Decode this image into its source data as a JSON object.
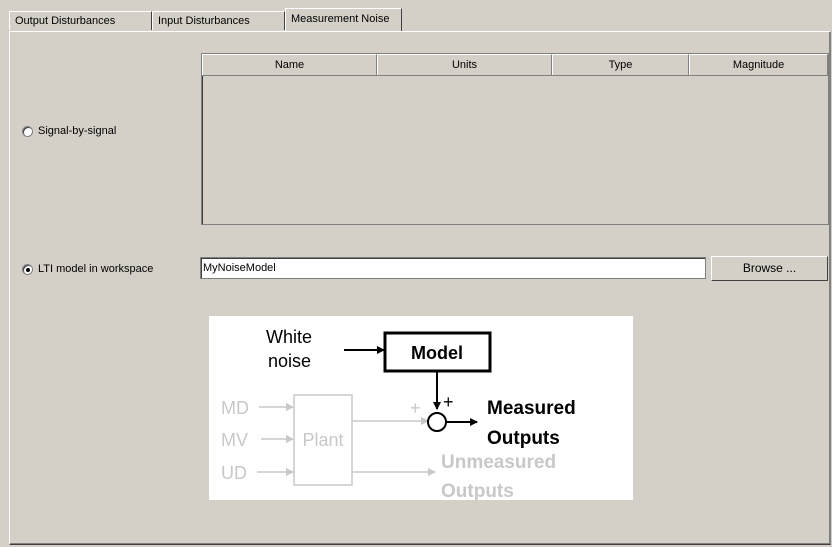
{
  "tabs": [
    {
      "label": "Output Disturbances"
    },
    {
      "label": "Input Disturbances"
    },
    {
      "label": "Measurement Noise"
    }
  ],
  "signal_by_signal": {
    "label": "Signal-by-signal",
    "selected": false
  },
  "table": {
    "columns": [
      "Name",
      "Units",
      "Type",
      "Magnitude"
    ],
    "rows": []
  },
  "lti": {
    "label": "LTI model in workspace",
    "selected": true,
    "value": "MyNoiseModel",
    "browse_label": "Browse ..."
  },
  "diagram": {
    "white_noise_1": "White",
    "white_noise_2": "noise",
    "model": "Model",
    "md": "MD",
    "mv": "MV",
    "ud": "UD",
    "plant": "Plant",
    "plus1": "+",
    "plus2": "+",
    "measured_1": "Measured",
    "measured_2": "Outputs",
    "unmeasured_1": "Unmeasured",
    "unmeasured_2": "Outputs"
  }
}
